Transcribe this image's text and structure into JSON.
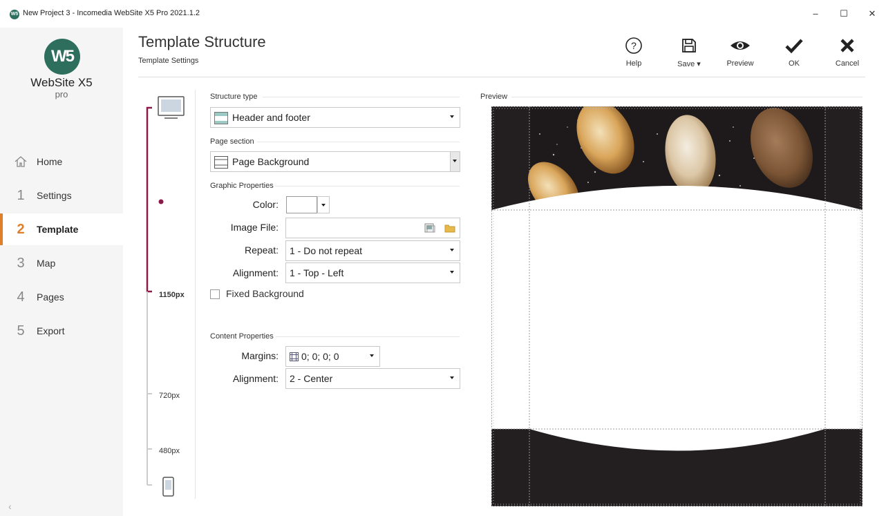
{
  "window": {
    "title": "New Project 3 - Incomedia WebSite X5 Pro 2021.1.2",
    "app_icon": "W5",
    "minimize": "–",
    "maximize": "☐",
    "close": "✕"
  },
  "logo": {
    "mark": "W5",
    "name": "WebSite X5",
    "edition": "pro"
  },
  "sidebar": {
    "items": [
      {
        "num": "",
        "label": "Home",
        "icon": "home-icon"
      },
      {
        "num": "1",
        "label": "Settings"
      },
      {
        "num": "2",
        "label": "Template"
      },
      {
        "num": "3",
        "label": "Map"
      },
      {
        "num": "4",
        "label": "Pages"
      },
      {
        "num": "5",
        "label": "Export"
      }
    ],
    "active": "Template",
    "collapse": "‹"
  },
  "header": {
    "title": "Template Structure",
    "subtitle": "Template Settings"
  },
  "toolbar": {
    "help": "Help",
    "save": "Save ▾",
    "preview": "Preview",
    "ok": "OK",
    "cancel": "Cancel"
  },
  "resolutions": {
    "r1": "1150px",
    "r2": "720px",
    "r3": "480px"
  },
  "form": {
    "structure_type_label": "Structure type",
    "structure_type_value": "Header and footer",
    "page_section_label": "Page section",
    "page_section_value": "Page Background",
    "graphic_props_label": "Graphic Properties",
    "color_label": "Color:",
    "image_file_label": "Image File:",
    "image_file_value": "",
    "repeat_label": "Repeat:",
    "repeat_value": "1 - Do not repeat",
    "alignment_label": "Alignment:",
    "alignment_value": "1 - Top - Left",
    "fixed_bg_label": "Fixed Background",
    "content_props_label": "Content Properties",
    "margins_label": "Margins:",
    "margins_value": "0; 0; 0; 0",
    "content_align_label": "Alignment:",
    "content_align_value": "2 - Center"
  },
  "preview": {
    "label": "Preview"
  },
  "colors": {
    "accent": "#e07f2a",
    "bracket": "#8b1a4a",
    "logo": "#2d6e5d",
    "dark": "#231f20"
  }
}
